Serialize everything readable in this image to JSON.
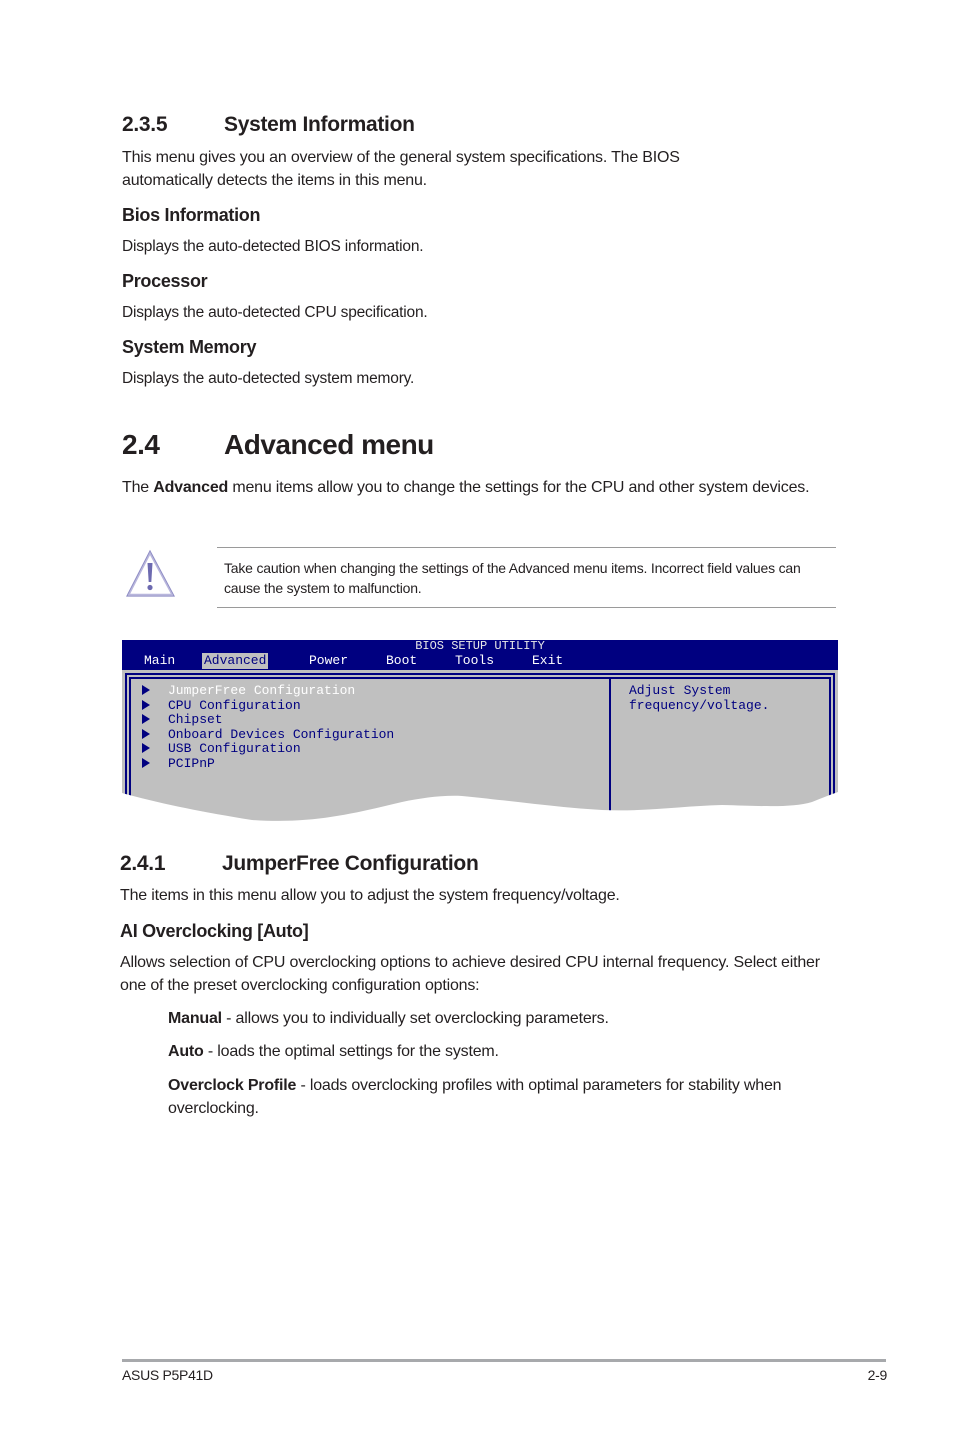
{
  "section_235": {
    "number": "2.3.5",
    "title": "System Information",
    "intro": "This menu gives you an overview of the general system specifications. The BIOS automatically detects the items in this menu.",
    "items": [
      {
        "heading": "Bios Information",
        "text": "Displays the auto-detected BIOS information."
      },
      {
        "heading": "Processor",
        "text": "Displays the auto-detected CPU specification."
      },
      {
        "heading": "System Memory",
        "text": "Displays the auto-detected system memory."
      }
    ]
  },
  "section_24": {
    "number": "2.4",
    "title": "Advanced menu",
    "intro_pre": "The ",
    "intro_bold": "Advanced",
    "intro_post": " menu items allow you to change the settings for the CPU and other system devices."
  },
  "caution": {
    "icon": "warning-triangle-icon",
    "text": "Take caution when changing the settings of the Advanced menu items. Incorrect field values can cause the system to malfunction."
  },
  "bios": {
    "title": "BIOS SETUP UTILITY",
    "tabs": [
      {
        "label": "Main",
        "active": false
      },
      {
        "label": "Advanced",
        "active": true
      },
      {
        "label": "Power",
        "active": false
      },
      {
        "label": "Boot",
        "active": false
      },
      {
        "label": "Tools",
        "active": false
      },
      {
        "label": "Exit",
        "active": false
      }
    ],
    "items": [
      {
        "label": "JumperFree Configuration",
        "selected": true
      },
      {
        "label": "CPU Configuration",
        "selected": false
      },
      {
        "label": "Chipset",
        "selected": false
      },
      {
        "label": "Onboard Devices Configuration",
        "selected": false
      },
      {
        "label": "USB Configuration",
        "selected": false
      },
      {
        "label": "PCIPnP",
        "selected": false
      }
    ],
    "help_text": "Adjust System\nfrequency/voltage.",
    "colors": {
      "header": "#000080",
      "body": "#c0c0c0",
      "text": "#000080",
      "selected": "#ffffff"
    }
  },
  "section_241": {
    "number": "2.4.1",
    "title": "JumperFree Configuration",
    "intro": "The items in this menu allow you to adjust the system frequency/voltage.",
    "setting_heading": "AI Overclocking [Auto]",
    "setting_desc": "Allows selection of CPU overclocking options to achieve desired CPU internal frequency. Select either one of the preset overclocking configuration options:",
    "options": [
      {
        "name": "Manual",
        "desc": " - allows you to individually set overclocking parameters."
      },
      {
        "name": "Auto",
        "desc": " - loads the optimal settings for the system."
      },
      {
        "name": "Overclock Profile",
        "desc": " - loads overclocking profiles with optimal parameters for stability when overclocking."
      }
    ]
  },
  "footer": {
    "product": "ASUS P5P41D",
    "page": "2-9"
  }
}
